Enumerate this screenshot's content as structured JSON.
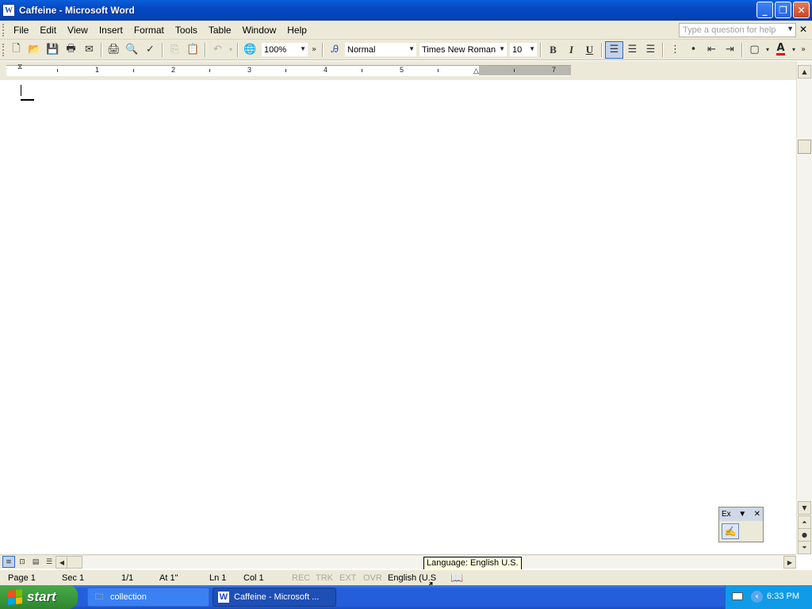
{
  "window": {
    "title": "Caffeine - Microsoft Word",
    "icon_letter": "W",
    "controls": [
      "minimize-icon",
      "restore-icon",
      "close-icon"
    ]
  },
  "menubar": {
    "items": [
      "File",
      "Edit",
      "View",
      "Insert",
      "Format",
      "Tools",
      "Table",
      "Window",
      "Help"
    ],
    "help_placeholder": "Type a question for help"
  },
  "toolbar": {
    "zoom": "100%",
    "style": "Normal",
    "font": "Times New Roman",
    "size": "10",
    "bold": "B",
    "italic": "I",
    "underline": "U",
    "font_color_letter": "A",
    "font_color": "#e00000"
  },
  "ruler": {
    "numbers": [
      "1",
      "2",
      "3",
      "4",
      "5",
      "7"
    ]
  },
  "tooltip": "Language: English U.S.",
  "statusbar": {
    "page": "Page 1",
    "section": "Sec 1",
    "pages": "1/1",
    "at": "At 1\"",
    "line": "Ln 1",
    "col": "Col 1",
    "rec": "REC",
    "trk": "TRK",
    "ext": "EXT",
    "ovr": "OVR",
    "language": "English (U.S"
  },
  "floating_toolbar": {
    "title": "Ex"
  },
  "taskbar": {
    "start": "start",
    "tasks": [
      {
        "label": "collection",
        "icon": "folder-icon"
      },
      {
        "label": "Caffeine - Microsoft ...",
        "icon": "word-icon"
      }
    ],
    "clock": "6:33 PM"
  },
  "colors": {
    "titlebar": "#0548c4",
    "chrome": "#ece9d8",
    "taskbar": "#245edb",
    "start": "#3b9a3b"
  }
}
